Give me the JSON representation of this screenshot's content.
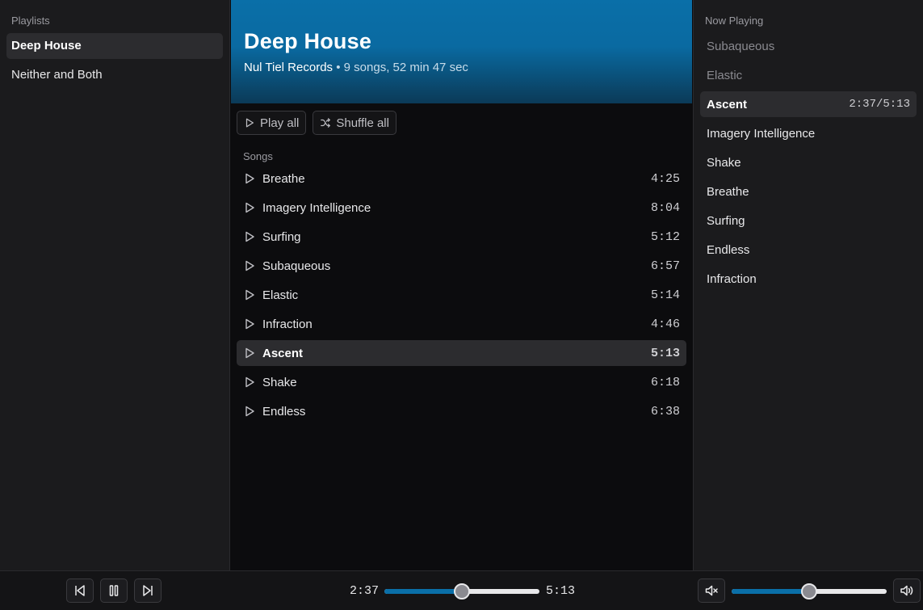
{
  "sidebar": {
    "title": "Playlists",
    "items": [
      {
        "label": "Deep House",
        "active": true
      },
      {
        "label": "Neither and Both",
        "active": false
      }
    ]
  },
  "hero": {
    "title": "Deep House",
    "label": "Nul Tiel Records",
    "separator": "•",
    "summary": "9 songs, 52 min 47 sec"
  },
  "actions": {
    "play_all": "Play all",
    "shuffle_all": "Shuffle all"
  },
  "songs": {
    "title": "Songs",
    "items": [
      {
        "title": "Breathe",
        "duration": "4:25"
      },
      {
        "title": "Imagery Intelligence",
        "duration": "8:04"
      },
      {
        "title": "Surfing",
        "duration": "5:12"
      },
      {
        "title": "Subaqueous",
        "duration": "6:57"
      },
      {
        "title": "Elastic",
        "duration": "5:14"
      },
      {
        "title": "Infraction",
        "duration": "4:46"
      },
      {
        "title": "Ascent",
        "duration": "5:13",
        "active": true
      },
      {
        "title": "Shake",
        "duration": "6:18"
      },
      {
        "title": "Endless",
        "duration": "6:38"
      }
    ]
  },
  "queue": {
    "title": "Now Playing",
    "items": [
      {
        "title": "Subaqueous",
        "state": "past"
      },
      {
        "title": "Elastic",
        "state": "past"
      },
      {
        "title": "Ascent",
        "state": "active",
        "time": "2:37/5:13"
      },
      {
        "title": "Imagery Intelligence",
        "state": "upcoming"
      },
      {
        "title": "Shake",
        "state": "upcoming"
      },
      {
        "title": "Breathe",
        "state": "upcoming"
      },
      {
        "title": "Surfing",
        "state": "upcoming"
      },
      {
        "title": "Endless",
        "state": "upcoming"
      },
      {
        "title": "Infraction",
        "state": "upcoming"
      }
    ]
  },
  "player": {
    "elapsed": "2:37",
    "total": "5:13",
    "progress_fraction": 0.5,
    "volume_fraction": 0.5,
    "accent_color": "#0a6fa8",
    "icons": [
      "skip-back-icon",
      "pause-icon",
      "skip-forward-icon",
      "volume-mute-icon",
      "volume-up-icon"
    ]
  }
}
